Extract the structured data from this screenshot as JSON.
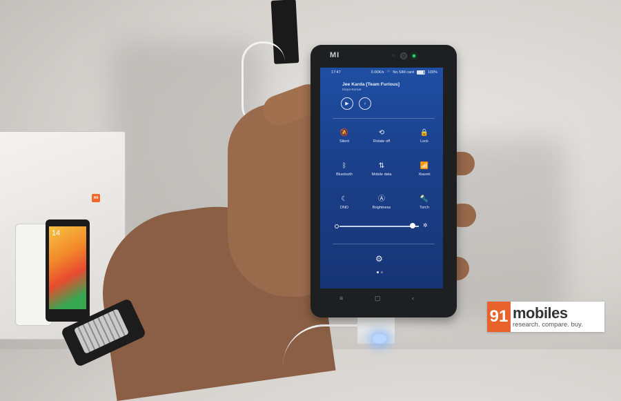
{
  "phone": {
    "brand_logo": "MI",
    "status_bar": {
      "time": "17:47",
      "speed": "0.00K/s",
      "sim": "No SIM card",
      "battery": "100%"
    },
    "music": {
      "song_title": "Jee Karda [Team Furious]",
      "artist": "Divya Kumar",
      "play_icon": "play-icon",
      "next_icon": "next-icon"
    },
    "toggles": [
      {
        "label": "Silent",
        "icon": "bell-off-icon",
        "glyph": "🔕"
      },
      {
        "label": "Rotate off",
        "icon": "rotate-lock-icon",
        "glyph": "⟲"
      },
      {
        "label": "Lock",
        "icon": "lock-icon",
        "glyph": "🔒"
      },
      {
        "label": "Bluetooth",
        "icon": "bluetooth-icon",
        "glyph": "ᛒ"
      },
      {
        "label": "Mobile data",
        "icon": "mobile-data-icon",
        "glyph": "⇅"
      },
      {
        "label": "Xiaomi",
        "icon": "wifi-icon",
        "glyph": "📶"
      },
      {
        "label": "DND",
        "icon": "moon-icon",
        "glyph": "☾"
      },
      {
        "label": "Brightness",
        "icon": "auto-brightness-icon",
        "glyph": "Ⓐ"
      },
      {
        "label": "Torch",
        "icon": "torch-icon",
        "glyph": "🔦"
      }
    ],
    "brightness_level": 0.92,
    "settings_icon": "gear-icon",
    "page_indicator": {
      "current": 1,
      "total": 2
    },
    "nav_buttons": [
      "≡",
      "▢",
      "‹"
    ]
  },
  "stand_phone_clock": "14",
  "stand_brand": "mi",
  "watermark": {
    "number": "91",
    "name": "mobiles",
    "tagline": "research. compare. buy."
  }
}
